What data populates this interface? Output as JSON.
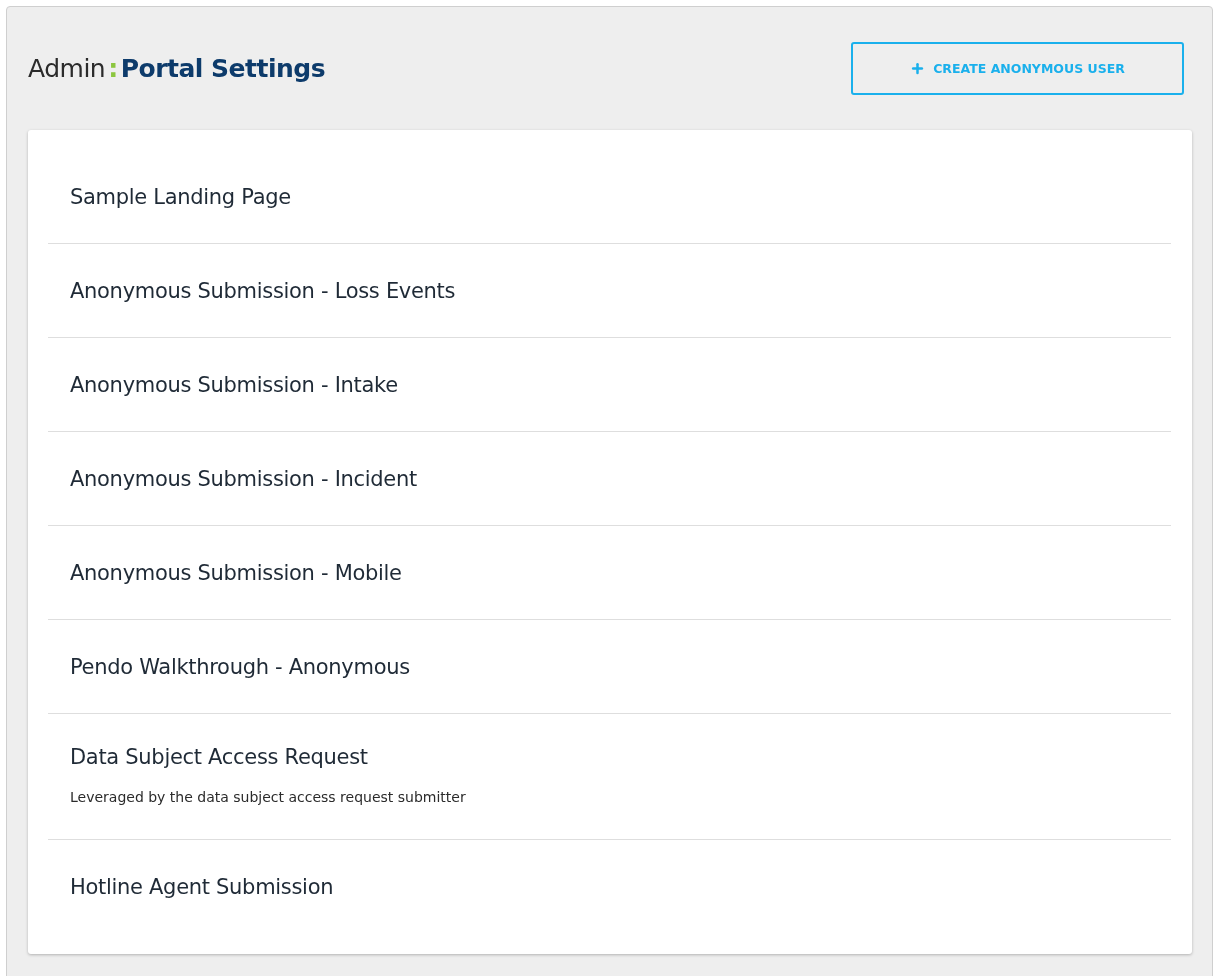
{
  "header": {
    "section": "Admin",
    "separator": ":",
    "title": "Portal Settings"
  },
  "create_button": {
    "label": "CREATE ANONYMOUS USER"
  },
  "portals": [
    {
      "name": "Sample Landing Page"
    },
    {
      "name": "Anonymous Submission - Loss Events"
    },
    {
      "name": "Anonymous Submission - Intake"
    },
    {
      "name": "Anonymous Submission - Incident"
    },
    {
      "name": "Anonymous Submission - Mobile"
    },
    {
      "name": "Pendo Walkthrough - Anonymous"
    },
    {
      "name": "Data Subject Access Request",
      "description": "Leveraged by the data subject access request submitter"
    },
    {
      "name": "Hotline Agent Submission"
    }
  ]
}
